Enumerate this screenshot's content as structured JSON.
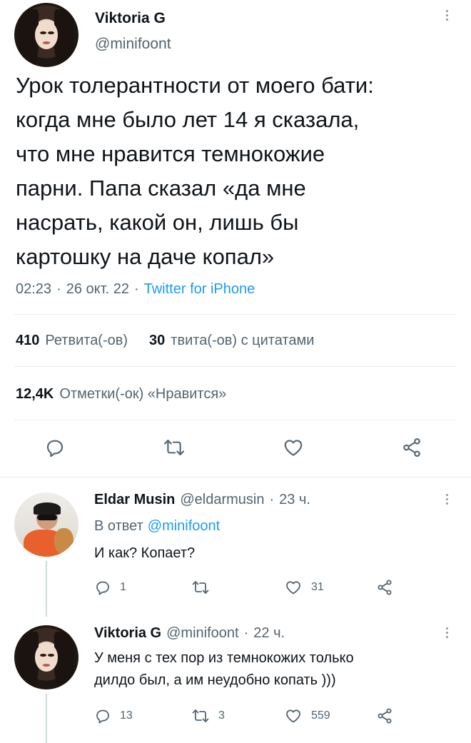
{
  "tweet": {
    "author_name": "Viktoria G",
    "author_handle": "@minifoont",
    "text": "Урок толерантности от моего бати:\nкогда мне было лет 14 я сказала,\nчто мне нравится темнокожие\nпарни. Папа сказал «да мне\nнасрать, какой он, лишь бы\nкартошку на даче копал»",
    "time": "02:23",
    "date": "26 окт. 22",
    "separator": "·",
    "source": "Twitter for iPhone"
  },
  "stats": {
    "retweets_count": "410",
    "retweets_label": "Ретвита(-ов)",
    "quotes_count": "30",
    "quotes_label": "твита(-ов) с цитатами",
    "likes_count": "12,4K",
    "likes_label": "Отметки(-ок) «Нравится»"
  },
  "replies": [
    {
      "author_name": "Eldar Musin",
      "author_handle": "@eldarmusin",
      "time": "23 ч.",
      "reply_to_prefix": "В ответ",
      "reply_to_handle": "@minifoont",
      "text": "И как? Копает?",
      "reply_count": "1",
      "retweet_count": "",
      "like_count": "31"
    },
    {
      "author_name": "Viktoria G",
      "author_handle": "@minifoont",
      "time": "22 ч.",
      "text": "У меня с тех пор из темнокожих только\nдилдо был, а им неудобно копать )))",
      "reply_count": "13",
      "retweet_count": "3",
      "like_count": "559"
    }
  ],
  "icons": {
    "reply": "reply-icon",
    "retweet": "retweet-icon",
    "like": "heart-icon",
    "share": "share-icon",
    "more": "more-dots-icon"
  },
  "colors": {
    "link": "#1d9bf0",
    "muted": "#536471",
    "divider": "#e8ecef"
  }
}
